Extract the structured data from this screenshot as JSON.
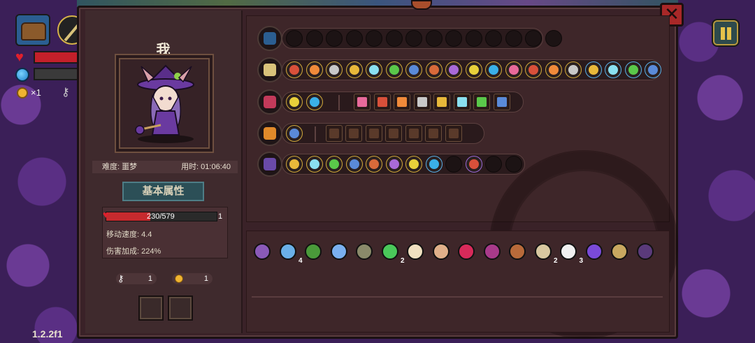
{
  "version": "1.2.2f1",
  "hud": {
    "coin_count": "×1",
    "icons": [
      "chest-icon",
      "staff-weapon-icon",
      "heart-icon",
      "mana-orb-icon",
      "coin-icon",
      "key-icon"
    ]
  },
  "dialog": {
    "close_label": "✕",
    "player_name": "我",
    "difficulty": "难度: 噩梦",
    "time": "用时: 01:06:40",
    "attr_title": "基本属性",
    "hp_text": "230/579",
    "hp_extra": "1",
    "hp_fraction": 0.397,
    "move_speed": "移动速度: 4.4",
    "damage_bonus": "伤害加成: 224%",
    "keys": "1",
    "coins": "1"
  },
  "colors": {
    "frame": "#3a2228",
    "panel": "#3f2a2d",
    "accent_gold": "#d2a93a",
    "hp_red": "#c62a2e",
    "attr_teal": "#2c4f57"
  },
  "rows": [
    {
      "icon": "chest-icon",
      "slots": 14,
      "filled": 0
    },
    {
      "icon": "staff-icon",
      "slots": 19,
      "filled": 19
    },
    {
      "icon": "heart-crest-icon",
      "slots": 10,
      "filled": 10
    },
    {
      "icon": "spellbook-icon",
      "slots": 8,
      "filled": 7
    },
    {
      "icon": "dagger-icon",
      "slots": 12,
      "filled": 10
    }
  ],
  "items": [
    {
      "name": "witch-portrait-item-icon",
      "count": ""
    },
    {
      "name": "crystal-lotus-item-icon",
      "count": "4"
    },
    {
      "name": "green-bell-item-icon",
      "count": ""
    },
    {
      "name": "blue-egg-item-icon",
      "count": ""
    },
    {
      "name": "spiked-mace-item-icon",
      "count": ""
    },
    {
      "name": "clover-item-icon",
      "count": "2"
    },
    {
      "name": "feather-item-icon",
      "count": ""
    },
    {
      "name": "bread-roll-item-icon",
      "count": ""
    },
    {
      "name": "red-eye-item-icon",
      "count": ""
    },
    {
      "name": "purple-fish-item-icon",
      "count": ""
    },
    {
      "name": "meat-item-icon",
      "count": ""
    },
    {
      "name": "bone-item-icon",
      "count": "2"
    },
    {
      "name": "teeth-item-icon",
      "count": "3"
    },
    {
      "name": "witch-hat-item-icon",
      "count": ""
    },
    {
      "name": "helmet-item-icon",
      "count": ""
    },
    {
      "name": "robe-item-icon",
      "count": ""
    }
  ]
}
